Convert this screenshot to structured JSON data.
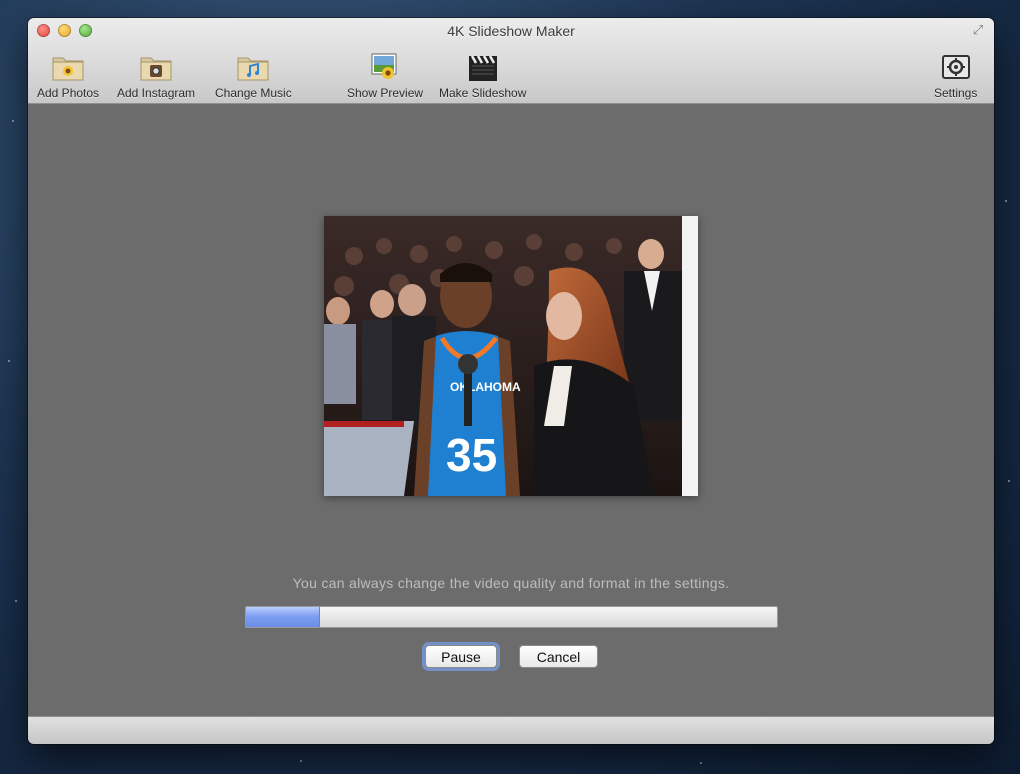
{
  "window": {
    "title": "4K Slideshow Maker"
  },
  "toolbar": {
    "add_photos": {
      "label": "Add Photos",
      "icon": "folder-photos-icon"
    },
    "add_instagram": {
      "label": "Add Instagram",
      "icon": "folder-instagram-icon"
    },
    "change_music": {
      "label": "Change Music",
      "icon": "folder-music-icon"
    },
    "show_preview": {
      "label": "Show Preview",
      "icon": "preview-photo-icon"
    },
    "make_slideshow": {
      "label": "Make Slideshow",
      "icon": "clapperboard-icon"
    },
    "settings": {
      "label": "Settings",
      "icon": "settings-icon"
    }
  },
  "main": {
    "hint": "You can always change the video quality and format in the settings.",
    "progress": 0.14,
    "pause_label": "Pause",
    "cancel_label": "Cancel",
    "photo": {
      "jersey_number": "35",
      "jersey_text": "OKLAHOMA"
    }
  },
  "colors": {
    "accent": "#7b9cf0",
    "content_bg": "#6c6c6c",
    "jersey": "#1f7fd0"
  }
}
